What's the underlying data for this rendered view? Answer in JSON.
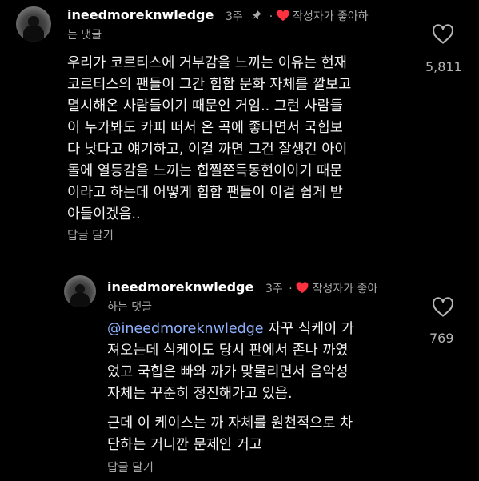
{
  "comment1": {
    "username": "ineedmoreknwledge",
    "time": "3주",
    "liked_by_author_line1": "작성자가 좋아하",
    "liked_by_author_line2": "는 댓글",
    "body_lines": [
      "우리가 코르티스에 거부감을 느끼는 이유는 현재",
      "코르티스의 팬들이 그간 힙합 문화 자체를 깔보고",
      "멸시해온 사람들이기 때문인 거임.. 그런 사람들",
      "이 누가봐도 카피 떠서 온 곡에 좋다면서 국힙보",
      "다 낫다고 얘기하고, 이걸 까면 그건 잘생긴 아이",
      "돌에 열등감을 느끼는 힙찔쯘득동현이이기 때문",
      "이라고 하는데 어떻게 힙합 팬들이 이걸 쉽게 받",
      "아들이겠음.."
    ],
    "reply_label": "답글 달기",
    "like_count": "5,811"
  },
  "comment2": {
    "username": "ineedmoreknwledge",
    "time": "3주",
    "liked_by_author_line1": "작성자가 좋아",
    "liked_by_author_line2": "하는 댓글",
    "mention": "@ineedmoreknwledge",
    "first_line_rest": " 자꾸 식케이 가",
    "body_lines": [
      "져오는데 식케이도 당시 판에서 존나 까였",
      "었고 국힙은 빠와 까가 맞물리면서 음악성",
      "자체는 꾸준히 정진해가고 있음."
    ],
    "body_lines_2": [
      "근데 이 케이스는 까 자체를 원천적으로 차",
      "단하는 거니깐 문제인 거고"
    ],
    "reply_label": "답글 달기",
    "like_count": "769"
  },
  "colors": {
    "background": "#000000",
    "heart_red": "#ff3040",
    "muted": "#a8a8a8",
    "mention": "#8fb3ff"
  },
  "icons": [
    "avatar",
    "pin-icon",
    "heart-filled-icon",
    "heart-outline-icon"
  ]
}
